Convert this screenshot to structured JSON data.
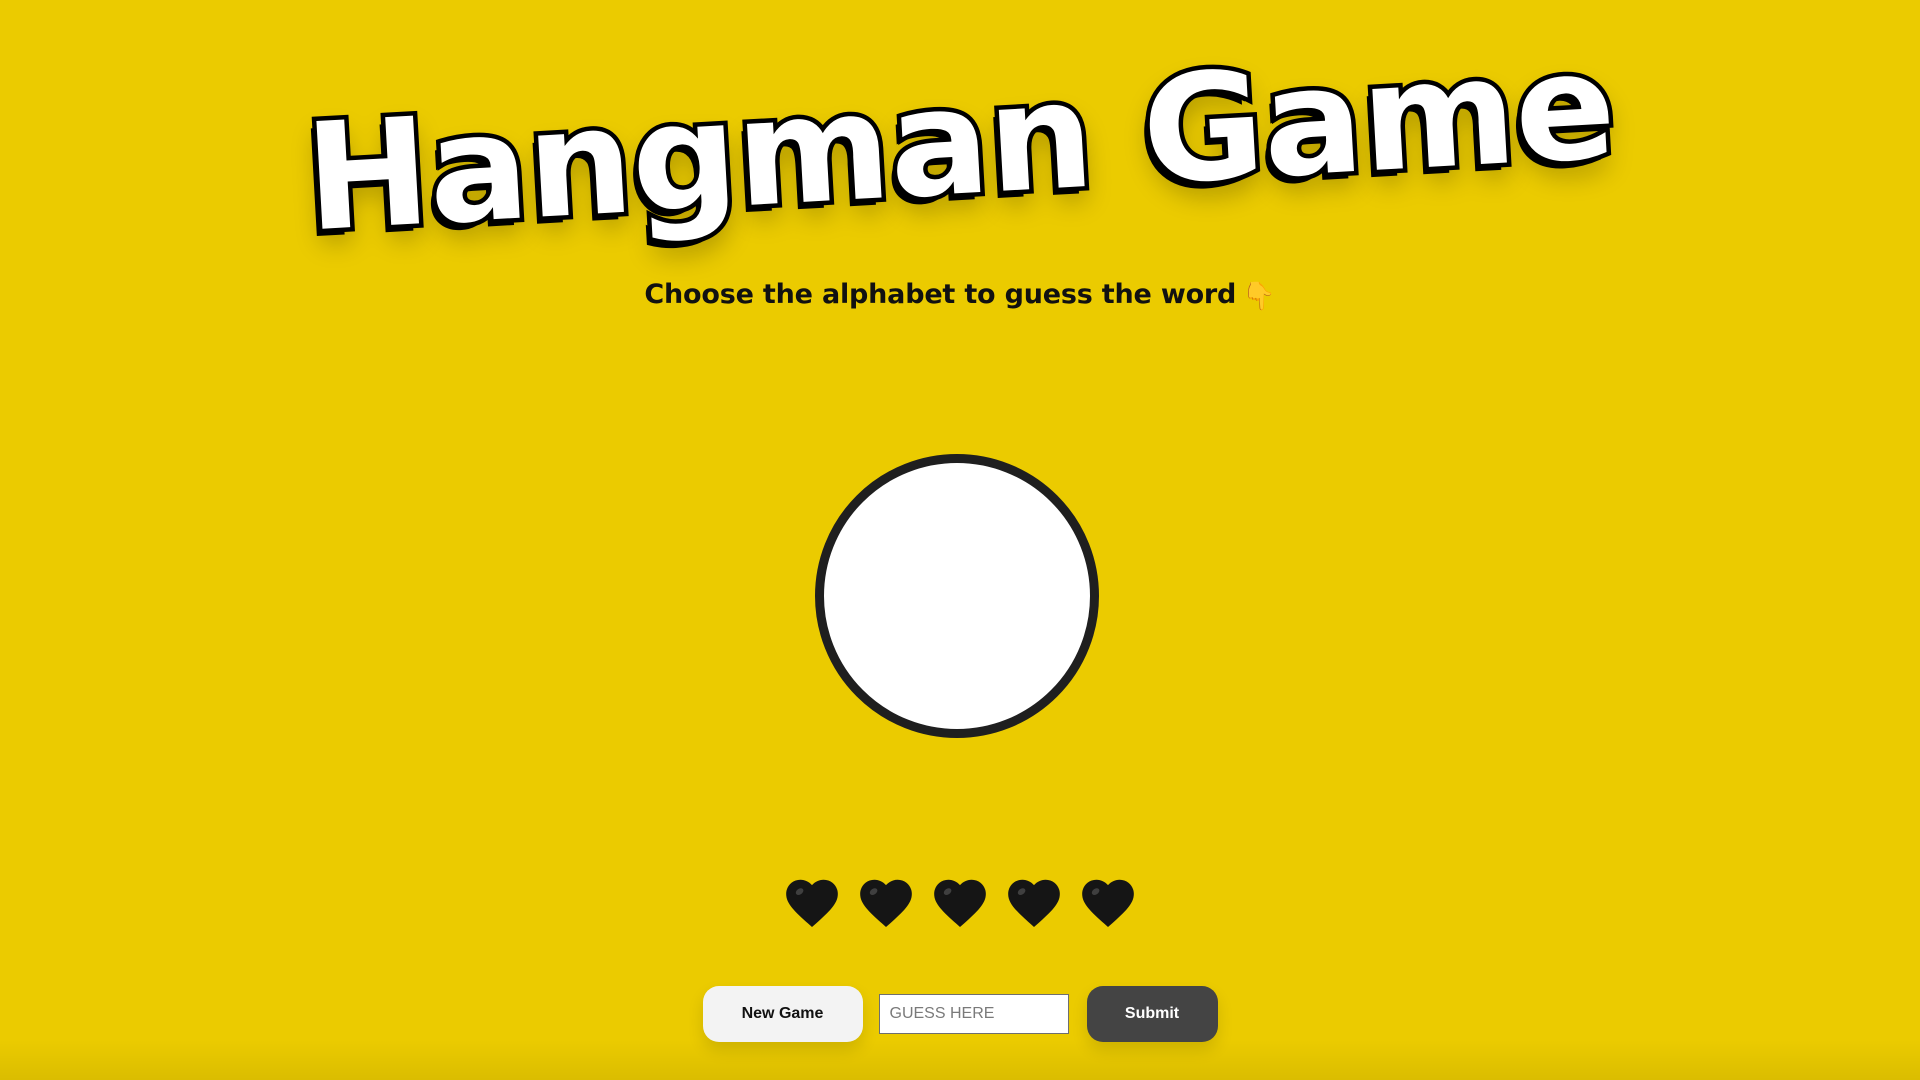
{
  "title": "Hangman Game",
  "subtitle": "Choose the alphabet to guess the word",
  "subtitle_icon": "pointing-down-hand-icon",
  "lives": {
    "count": 5,
    "icon": "black-heart-icon"
  },
  "controls": {
    "new_game_label": "New Game",
    "guess_placeholder": "GUESS HERE",
    "guess_value": "",
    "submit_label": "Submit"
  },
  "colors": {
    "background": "#ebcb00",
    "title_fill": "#ffffff",
    "title_outline": "#000000",
    "circle_fill": "#ffffff",
    "circle_border": "#1f1f1f",
    "heart": "#151515",
    "new_game_bg": "#f3f3f3",
    "submit_bg": "#444444"
  }
}
